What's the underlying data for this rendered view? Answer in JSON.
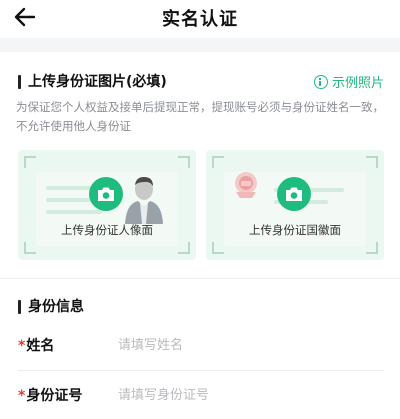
{
  "header": {
    "title": "实名认证",
    "back_icon": "arrow-left-icon"
  },
  "upload_section": {
    "title": "上传身份证图片(必填)",
    "example_label": "示例照片",
    "description": "为保证您个人权益及接单后提现正常，提现账号必须与身份证姓名一致，不允许使用他人身份证",
    "cards": [
      {
        "label": "上传身份证人像面",
        "icon": "camera-icon"
      },
      {
        "label": "上传身份证国徽面",
        "icon": "camera-icon"
      }
    ]
  },
  "identity_section": {
    "title": "身份信息",
    "fields": [
      {
        "label": "姓名",
        "placeholder": "请填写姓名",
        "value": ""
      },
      {
        "label": "身份证号",
        "placeholder": "请填写身份证号",
        "value": ""
      }
    ]
  },
  "colors": {
    "accent": "#1fbc7f",
    "required": "#e53935",
    "card_bg": "#ebf7f1"
  }
}
